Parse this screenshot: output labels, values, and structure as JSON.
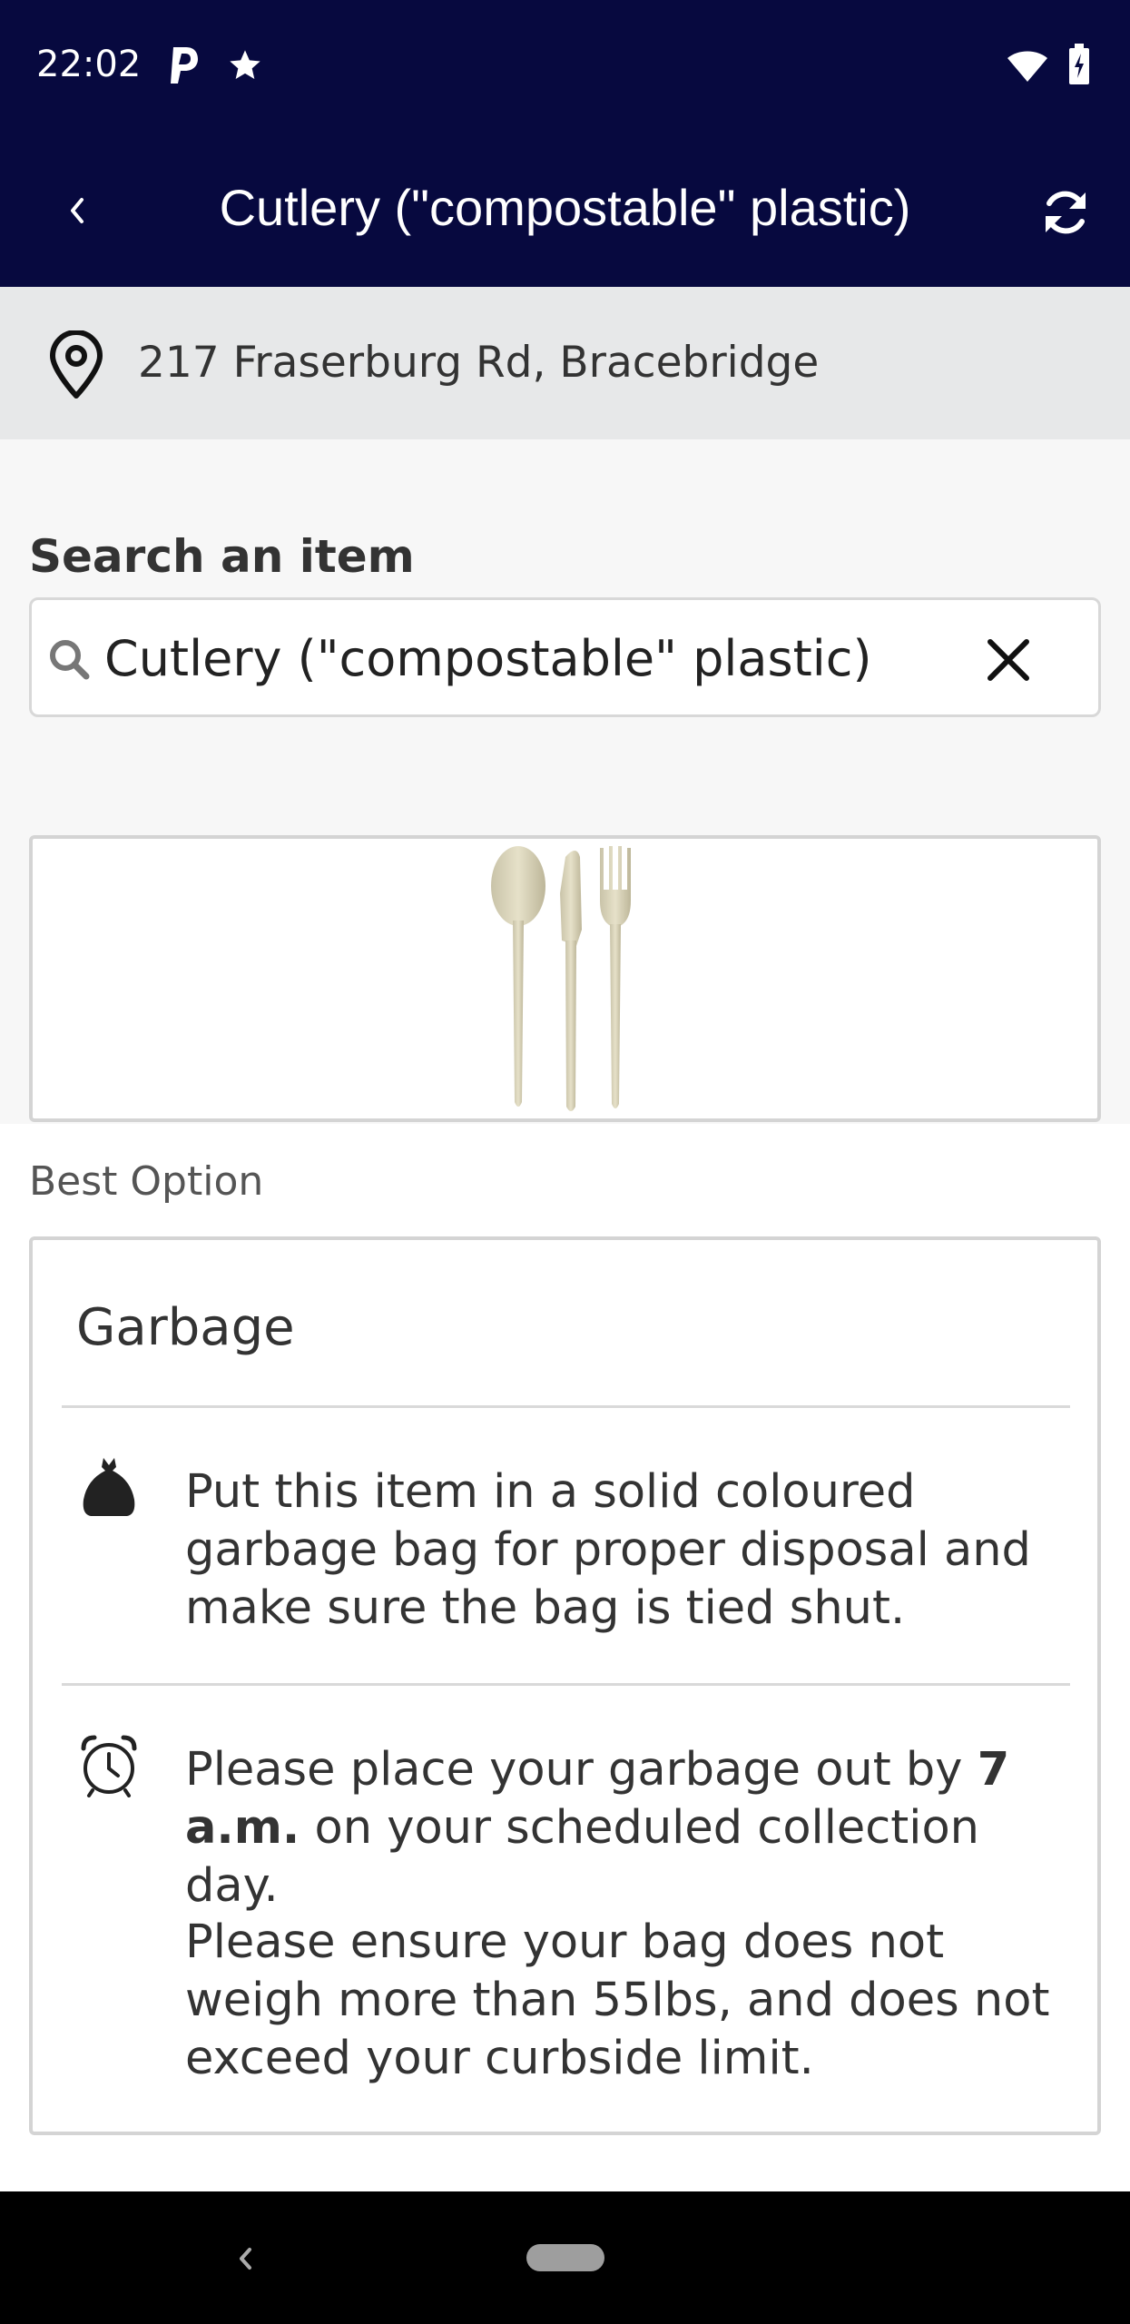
{
  "status_bar": {
    "time": "22:02",
    "icons": [
      "parking-p-icon",
      "star-icon",
      "wifi-icon",
      "battery-icon"
    ]
  },
  "app_bar": {
    "title": "Cutlery (\"compostable\" plastic)",
    "back_icon": "chevron-left-icon",
    "refresh_icon": "refresh-icon",
    "background": "#07093f"
  },
  "address": {
    "icon": "location-pin-icon",
    "text": "217 Fraserburg Rd, Bracebridge"
  },
  "search": {
    "label": "Search an item",
    "value": "Cutlery (\"compostable\" plastic)",
    "placeholder": "",
    "search_icon": "search-icon",
    "clear_icon": "close-icon"
  },
  "item_image": {
    "alt": "cutlery-image"
  },
  "best_option": {
    "label": "Best Option",
    "title": "Garbage",
    "rows": [
      {
        "icon": "garbage-bag-icon",
        "text": "Put this item in a solid coloured garbage bag for proper disposal and make sure the bag is tied shut."
      },
      {
        "icon": "alarm-clock-icon",
        "text_before": "Please place your garbage out by ",
        "text_bold": "7 a.m.",
        "text_after": " on your scheduled collection day.",
        "text_second": "Please ensure your bag does not weigh more than 55lbs, and does not exceed your curbside limit."
      }
    ]
  },
  "nav_bar": {
    "back_icon": "nav-back-icon",
    "home_icon": "nav-home-pill-icon"
  }
}
